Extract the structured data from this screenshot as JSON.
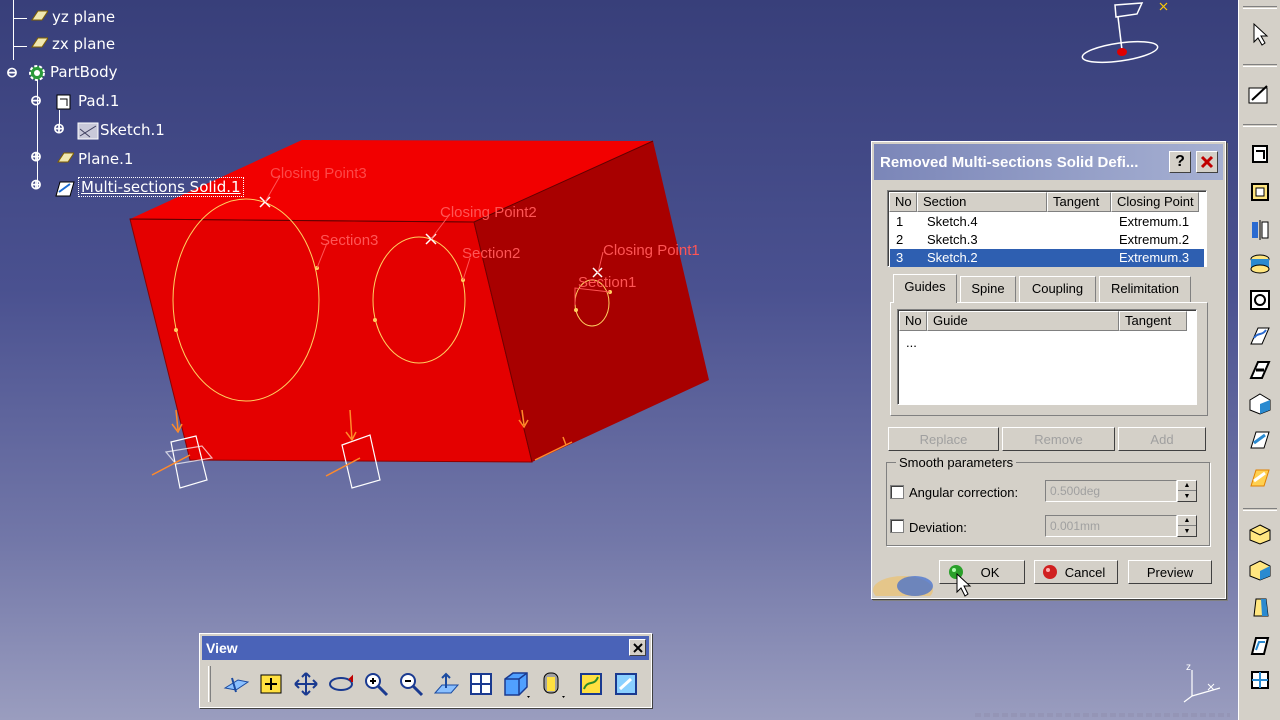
{
  "tree": {
    "items": [
      {
        "label": "yz plane"
      },
      {
        "label": "zx plane"
      },
      {
        "label": "PartBody"
      },
      {
        "label": "Pad.1"
      },
      {
        "label": "Sketch.1"
      },
      {
        "label": "Plane.1"
      },
      {
        "label": "Multi-sections Solid.1"
      }
    ]
  },
  "viewport": {
    "annotations": {
      "section1": "Section1",
      "section2": "Section2",
      "section3": "Section3",
      "closing_point1": "Closing Point1",
      "closing_point2": "Closing Point2",
      "closing_point3": "Closing Point3"
    },
    "colors": {
      "solid_front": "#e00000",
      "solid_top": "#f40000",
      "solid_side": "#a00000",
      "annotation": "#ff5555",
      "section_curve": "#ffd060"
    }
  },
  "dialog": {
    "title": "Removed Multi-sections Solid Defi...",
    "help_label": "?",
    "sections_table": {
      "headers": [
        "No",
        "Section",
        "Tangent",
        "Closing Point"
      ],
      "rows": [
        {
          "no": "1",
          "section": "Sketch.4",
          "tangent": "",
          "closing_point": "Extremum.1"
        },
        {
          "no": "2",
          "section": "Sketch.3",
          "tangent": "",
          "closing_point": "Extremum.2"
        },
        {
          "no": "3",
          "section": "Sketch.2",
          "tangent": "",
          "closing_point": "Extremum.3"
        }
      ]
    },
    "tabs": [
      "Guides",
      "Spine",
      "Coupling",
      "Relimitation"
    ],
    "guides_table": {
      "headers": [
        "No",
        "Guide",
        "Tangent"
      ],
      "rows": [
        {
          "no": "...",
          "guide": "",
          "tangent": ""
        }
      ]
    },
    "list_buttons": {
      "replace": "Replace",
      "remove": "Remove",
      "add": "Add"
    },
    "smooth": {
      "title": "Smooth parameters",
      "angular_label": "Angular correction:",
      "angular_value": "0.500deg",
      "deviation_label": "Deviation:",
      "deviation_value": "0.001mm"
    },
    "buttons": {
      "ok": "OK",
      "cancel": "Cancel",
      "preview": "Preview"
    }
  },
  "view_toolbar": {
    "title": "View",
    "buttons": [
      "fly-mode-icon",
      "fit-all-in-icon",
      "pan-icon",
      "rotate-icon",
      "zoom-in-icon",
      "zoom-out-icon",
      "normal-view-icon",
      "multi-view-icon",
      "isometric-view-icon",
      "shading-icon",
      "hide-show-icon",
      "swap-visible-space-icon"
    ]
  },
  "right_toolbar": {
    "icons": [
      "select-icon",
      "sketcher-icon",
      "pad-icon",
      "pocket-icon",
      "shaft-icon",
      "groove-icon",
      "hole-icon",
      "rib-icon",
      "slot-icon",
      "stiffener-icon",
      "multi-sections-solid-icon",
      "removed-multi-sections-solid-icon",
      "fillet-icon",
      "chamfer-icon",
      "draft-icon",
      "shell-icon",
      "thickness-icon"
    ]
  }
}
